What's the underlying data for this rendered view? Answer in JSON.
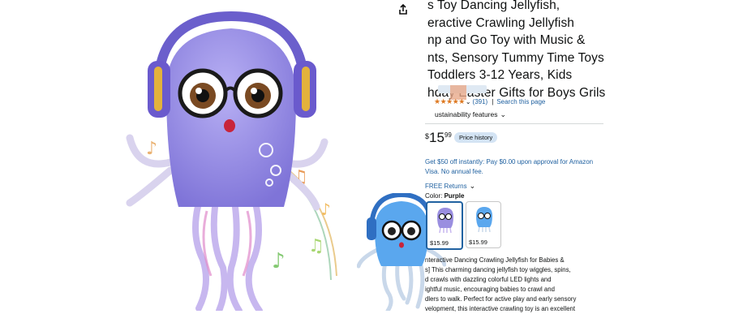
{
  "product": {
    "title_lines": [
      "s Toy Dancing Jellyfish,",
      "eractive Crawling Jellyfish",
      "np and Go Toy with Music &",
      "nts, Sensory Tummy Time Toys",
      "Toddlers 3-12 Years, Kids",
      "hday Easter Gifts for Boys Grils"
    ]
  },
  "rating": {
    "stars_glyph": "★★★★★",
    "count": "(391)",
    "separator": "|",
    "search_link": "Search this page"
  },
  "sustainability": {
    "label": "ustainability features"
  },
  "price": {
    "symbol": "$",
    "whole": "15",
    "fraction": "99",
    "history_button": "Price history"
  },
  "offer": {
    "text": "Get $50 off instantly: Pay $0.00 upon approval for Amazon Visa. No annual fee."
  },
  "returns": {
    "label": "FREE Returns"
  },
  "color": {
    "label": "Color:",
    "selected": "Purple",
    "options": [
      {
        "name": "Purple",
        "price": "$15.99",
        "color": "#9a8ee0"
      },
      {
        "name": "Blue",
        "price": "$15.99",
        "color": "#5aa7ee"
      }
    ]
  },
  "description": {
    "lines": [
      "nteractive Dancing Crawling Jellyfish for Babies &",
      "s]   This charming dancing jellyfish toy wiggles, spins,",
      "d crawls with dazzling colorful LED lights and",
      "ightful music, encouraging babies to crawl and",
      "dlers to walk. Perfect for active play and early sensory",
      "velopment, this interactive crawling toy is an excellent"
    ]
  },
  "colors": {
    "link": "#2162a1",
    "star": "#de7921",
    "selected_border": "#2162a1"
  }
}
